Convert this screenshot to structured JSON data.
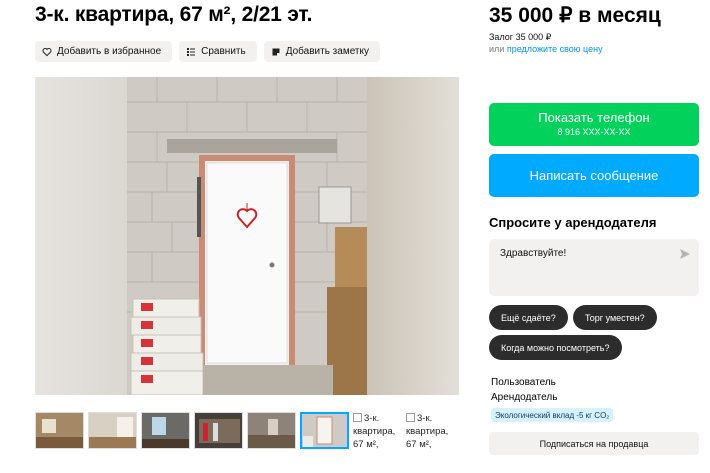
{
  "listing": {
    "title": "3-к. квартира, 67 м², 2/21 эт."
  },
  "actions": {
    "favorite": "Добавить в избранное",
    "compare": "Сравнить",
    "note": "Добавить заметку"
  },
  "gallery": {
    "thumb_alt": "3-к. квартира, 67 м²,"
  },
  "pricing": {
    "price": "35 000 ₽ в месяц",
    "deposit": "Залог 35 000 ₽",
    "offer_prefix": "или",
    "offer_link": "предложите свою цену"
  },
  "contact": {
    "show_phone": "Показать телефон",
    "phone_masked": "8 916 XXX-XX-XX",
    "write_message": "Написать сообщение"
  },
  "ask": {
    "title": "Спросите у арендодателя",
    "message": "Здравствуйте!",
    "chips": [
      "Ещё сдаёте?",
      "Торг уместен?",
      "Когда можно посмотреть?"
    ]
  },
  "seller": {
    "name": "Пользователь",
    "role": "Арендодатель",
    "eco_badge": "Экологический вклад -5 кг CO₂",
    "subscribe": "Подписаться на продавца"
  },
  "colors": {
    "green": "#02d15c",
    "blue": "#00aaff",
    "link": "#0095e5"
  }
}
